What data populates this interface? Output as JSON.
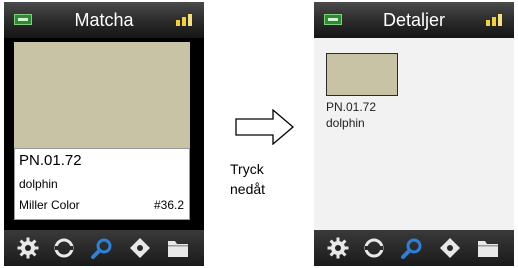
{
  "left_screen": {
    "title": "Matcha",
    "swatch_color": "#c7c3a4",
    "color_code": "PN.01.72",
    "color_name": "dolphin",
    "library": "Miller Color",
    "match_number": "#36.2"
  },
  "right_screen": {
    "title": "Detaljer",
    "swatch_color": "#c7c3a4",
    "color_code": "PN.01.72",
    "color_name": "dolphin"
  },
  "instruction": {
    "line1": "Tryck",
    "line2": "nedåt"
  },
  "toolbar_icons": [
    "gear-icon",
    "circle-arrows-icon",
    "search-icon",
    "target-icon",
    "folder-icon"
  ],
  "colors": {
    "accent_blue": "#2e7fd6",
    "battery_green": "#2f8b2f",
    "signal_yellow": "#f1d23a"
  }
}
